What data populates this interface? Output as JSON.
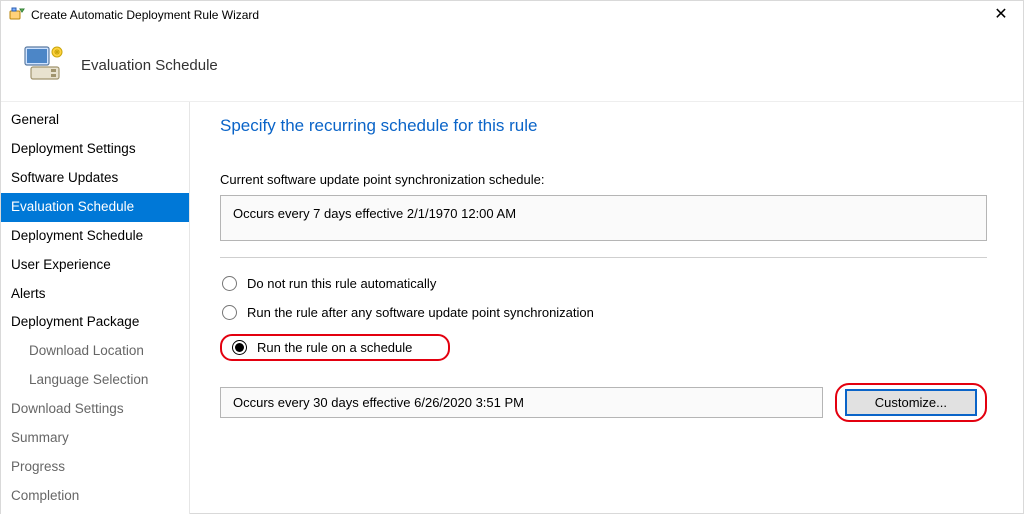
{
  "titlebar": {
    "title": "Create Automatic Deployment Rule Wizard"
  },
  "banner": {
    "title": "Evaluation Schedule"
  },
  "sidebar": {
    "items": [
      {
        "label": "General",
        "selected": false,
        "sub": false,
        "muted": false
      },
      {
        "label": "Deployment Settings",
        "selected": false,
        "sub": false,
        "muted": false
      },
      {
        "label": "Software Updates",
        "selected": false,
        "sub": false,
        "muted": false
      },
      {
        "label": "Evaluation Schedule",
        "selected": true,
        "sub": false,
        "muted": false
      },
      {
        "label": "Deployment Schedule",
        "selected": false,
        "sub": false,
        "muted": false
      },
      {
        "label": "User Experience",
        "selected": false,
        "sub": false,
        "muted": false
      },
      {
        "label": "Alerts",
        "selected": false,
        "sub": false,
        "muted": false
      },
      {
        "label": "Deployment Package",
        "selected": false,
        "sub": false,
        "muted": false
      },
      {
        "label": "Download Location",
        "selected": false,
        "sub": true,
        "muted": true
      },
      {
        "label": "Language Selection",
        "selected": false,
        "sub": true,
        "muted": true
      },
      {
        "label": "Download Settings",
        "selected": false,
        "sub": false,
        "muted": true
      },
      {
        "label": "Summary",
        "selected": false,
        "sub": false,
        "muted": true
      },
      {
        "label": "Progress",
        "selected": false,
        "sub": false,
        "muted": true
      },
      {
        "label": "Completion",
        "selected": false,
        "sub": false,
        "muted": true
      }
    ]
  },
  "content": {
    "heading": "Specify the recurring schedule for this rule",
    "sync_label": "Current software update point synchronization schedule:",
    "sync_value": "Occurs every 7 days effective 2/1/1970 12:00 AM",
    "options": {
      "opt1": "Do not run this rule automatically",
      "opt2": "Run the rule after any software update point synchronization",
      "opt3": "Run the rule on a schedule"
    },
    "schedule_value": "Occurs every 30 days effective 6/26/2020 3:51 PM",
    "customize_label": "Customize..."
  }
}
